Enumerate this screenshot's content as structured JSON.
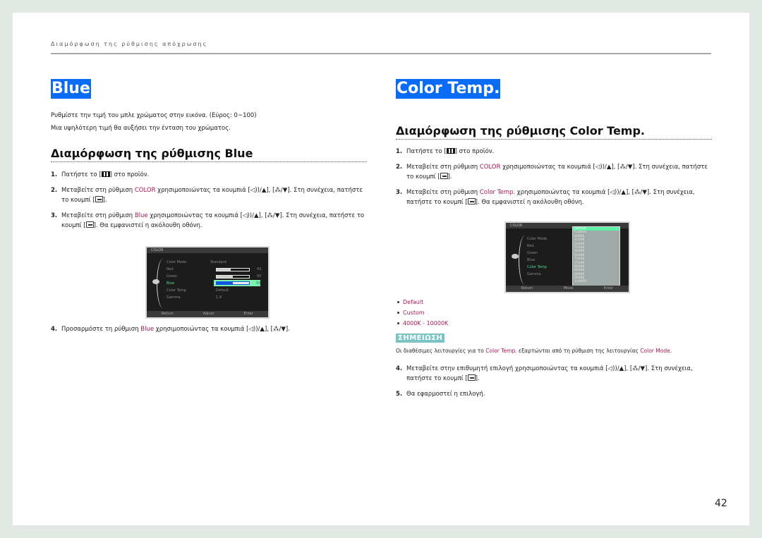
{
  "running_head": "Διαμόρφωση της ρύθμισης απόχρωσης",
  "page_number": "42",
  "colors": {
    "title_bg": "#0a6cf5",
    "highlight": "#a0185a",
    "note_bg": "#7cc4c4",
    "osd_active": "#4fdc8a"
  },
  "left": {
    "title": "Blue",
    "desc": [
      "Ρυθμίστε την τιμή του μπλε χρώματος στην εικόνα. (Εύρος: 0~100)",
      "Μια υψηλότερη τιμή θα αυξήσει την ένταση του χρώματος."
    ],
    "section_title": "Διαμόρφωση της ρύθμισης Blue",
    "steps": [
      {
        "num": "1.",
        "pre": "Πατήστε το [",
        "post": "] στο προϊόν."
      },
      {
        "num": "2.",
        "pre": "Μεταβείτε στη ρύθμιση ",
        "hl": "COLOR",
        "mid": " χρησιμοποιώντας τα κουμπιά [◁))/▲], [⁂/▼]. Στη συνέχεια, πατήστε το κουμπί [",
        "post": "]."
      },
      {
        "num": "3.",
        "pre": "Μεταβείτε στη ρύθμιση ",
        "hl": "Blue",
        "mid": " χρησιμοποιώντας τα κουμπιά [◁))/▲], [⁂/▼]. Στη συνέχεια, πατήστε το κουμπί [",
        "post": "]. Θα εμφανιστεί η ακόλουθη οθόνη."
      },
      {
        "num": "4.",
        "pre": "Προσαρμόστε τη ρύθμιση ",
        "hl": "Blue",
        "mid": " χρησιμοποιώντας τα κουμπιά [◁))/▲], [⁂/▼]."
      }
    ],
    "osd": {
      "title": "COLOR",
      "rows": [
        {
          "label": "Color Mode",
          "value": "Standard"
        },
        {
          "label": "Red",
          "value": "43",
          "level": 0.43
        },
        {
          "label": "Green",
          "value": "50",
          "level": 0.5
        },
        {
          "label": "Blue",
          "value": "50",
          "level": 0.5,
          "active": true
        },
        {
          "label": "Color Temp",
          "value": "Default"
        },
        {
          "label": "Gamma",
          "value": "1.9"
        }
      ],
      "footer": [
        "Return",
        "Adjust",
        "Enter"
      ]
    }
  },
  "right": {
    "title": "Color Temp.",
    "section_title": "Διαμόρφωση της ρύθμισης Color Temp.",
    "steps": [
      {
        "num": "1.",
        "pre": "Πατήστε το [",
        "post": "] στο προϊόν."
      },
      {
        "num": "2.",
        "pre": "Μεταβείτε στη ρύθμιση ",
        "hl": "COLOR",
        "mid": " χρησιμοποιώντας τα κουμπιά [◁))/▲], [⁂/▼]. Στη συνέχεια, πατήστε το κουμπί [",
        "post": "]."
      },
      {
        "num": "3.",
        "pre": "Μεταβείτε στη ρύθμιση ",
        "hl": "Color Temp.",
        "mid": " χρησιμοποιώντας τα κουμπιά [◁))/▲], [⁂/▼]. Στη συνέχεια, πατήστε το κουμπί [",
        "post": "]. Θα εμφανιστεί η ακόλουθη οθόνη."
      }
    ],
    "osd": {
      "title": "COLOR",
      "rows": [
        "Color Mode",
        "Red",
        "Green",
        "Blue",
        "Color Temp",
        "Gamma"
      ],
      "active_row": "Color Temp",
      "options": [
        "Default",
        "Custom",
        "4000K",
        "4500K",
        "5000K",
        "5500K",
        "6000K",
        "6500K",
        "7000K",
        "7500K",
        "8000K",
        "8500K",
        "9000K",
        "9500K",
        "10000K"
      ],
      "selected_option": "Default",
      "footer": [
        "Return",
        "Move",
        "Enter"
      ]
    },
    "bullets": [
      "Default",
      "Custom",
      "4000K - 10000K"
    ],
    "note": {
      "label": "ΣΗΜΕΙΩΣΗ",
      "pre": "Οι διαθέσιμες λειτουργίες για το ",
      "hl1": "Color Temp.",
      "mid": " εξαρτώνται από τη ρύθμιση της λειτουργίας ",
      "hl2": "Color Mode",
      "post": "."
    },
    "steps2": [
      {
        "num": "4.",
        "pre": "Μεταβείτε στην επιθυμητή επιλογή χρησιμοποιώντας τα κουμπιά [◁))/▲], [⁂/▼]. Στη συνέχεια, πατήστε το κουμπί [",
        "post": "]."
      },
      {
        "num": "5.",
        "pre": "Θα εφαρμοστεί η επιλογή."
      }
    ]
  }
}
